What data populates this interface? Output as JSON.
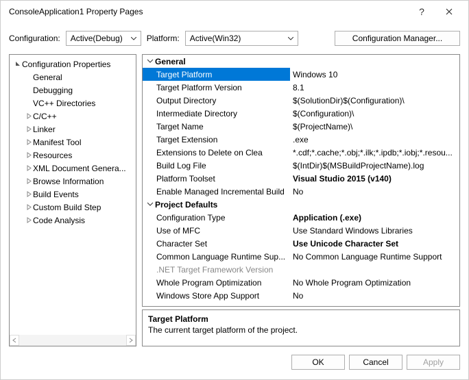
{
  "window": {
    "title": "ConsoleApplication1 Property Pages"
  },
  "toolbar": {
    "configuration_label": "Configuration:",
    "configuration_value": "Active(Debug)",
    "platform_label": "Platform:",
    "platform_value": "Active(Win32)",
    "cfgmgr_label": "Configuration Manager..."
  },
  "tree": {
    "root_label": "Configuration Properties",
    "items": [
      {
        "label": "General",
        "expandable": false,
        "selected": true
      },
      {
        "label": "Debugging",
        "expandable": false
      },
      {
        "label": "VC++ Directories",
        "expandable": false
      },
      {
        "label": "C/C++",
        "expandable": true
      },
      {
        "label": "Linker",
        "expandable": true
      },
      {
        "label": "Manifest Tool",
        "expandable": true
      },
      {
        "label": "Resources",
        "expandable": true
      },
      {
        "label": "XML Document Genera...",
        "expandable": true
      },
      {
        "label": "Browse Information",
        "expandable": true
      },
      {
        "label": "Build Events",
        "expandable": true
      },
      {
        "label": "Custom Build Step",
        "expandable": true
      },
      {
        "label": "Code Analysis",
        "expandable": true
      }
    ]
  },
  "grid": {
    "groups": [
      {
        "title": "General",
        "rows": [
          {
            "name": "Target Platform",
            "value": "Windows 10",
            "selected": true
          },
          {
            "name": "Target Platform Version",
            "value": "8.1"
          },
          {
            "name": "Output Directory",
            "value": "$(SolutionDir)$(Configuration)\\"
          },
          {
            "name": "Intermediate Directory",
            "value": "$(Configuration)\\"
          },
          {
            "name": "Target Name",
            "value": "$(ProjectName)\\"
          },
          {
            "name": "Target Extension",
            "value": ".exe"
          },
          {
            "name": "Extensions to Delete on Clea",
            "value": "*.cdf;*.cache;*.obj;*.ilk;*.ipdb;*.iobj;*.resou..."
          },
          {
            "name": "Build Log File",
            "value": "$(IntDir)$(MSBuildProjectName).log"
          },
          {
            "name": "Platform Toolset",
            "value": "Visual Studio 2015 (v140)",
            "bold": true
          },
          {
            "name": "Enable Managed Incremental Build",
            "value": "No"
          }
        ]
      },
      {
        "title": "Project Defaults",
        "rows": [
          {
            "name": "Configuration Type",
            "value": "Application (.exe)",
            "bold": true
          },
          {
            "name": "Use of MFC",
            "value": "Use Standard Windows Libraries"
          },
          {
            "name": "Character Set",
            "value": "Use Unicode Character Set",
            "bold": true
          },
          {
            "name": "Common Language Runtime Sup...",
            "value": "No Common Language Runtime Support"
          },
          {
            "name": ".NET Target Framework Version",
            "value": "",
            "disabled": true
          },
          {
            "name": "Whole Program Optimization",
            "value": "No Whole Program Optimization"
          },
          {
            "name": "Windows Store App Support",
            "value": "No"
          }
        ]
      }
    ]
  },
  "description": {
    "title": "Target Platform",
    "text": "The current target platform of the project."
  },
  "footer": {
    "ok": "OK",
    "cancel": "Cancel",
    "apply": "Apply"
  }
}
